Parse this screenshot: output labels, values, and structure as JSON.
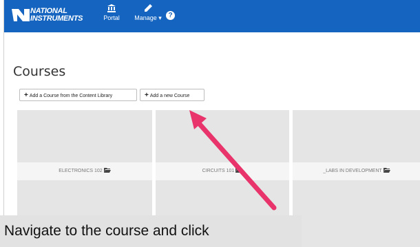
{
  "header": {
    "logo_line1": "NATIONAL",
    "logo_line2": "INSTRUMENTS",
    "nav": [
      {
        "label": "Portal",
        "icon": "bank-icon"
      },
      {
        "label": "Manage ▾",
        "icon": "pencil-icon"
      }
    ],
    "help_glyph": "?"
  },
  "page": {
    "title": "Courses",
    "buttons": [
      {
        "label": "Add a Course from the Content Library"
      },
      {
        "label": "Add a new Course"
      }
    ]
  },
  "courses": [
    {
      "name": "ELECTRONICS 102"
    },
    {
      "name": "CIRCUITS 101"
    },
    {
      "name": "_LABS IN DEVELOPMENT"
    }
  ],
  "annotation": {
    "caption": "Navigate to the course and click",
    "arrow_color": "#e8336b"
  },
  "colors": {
    "topbar": "#1565c0",
    "tile": "#e5e5e5"
  }
}
